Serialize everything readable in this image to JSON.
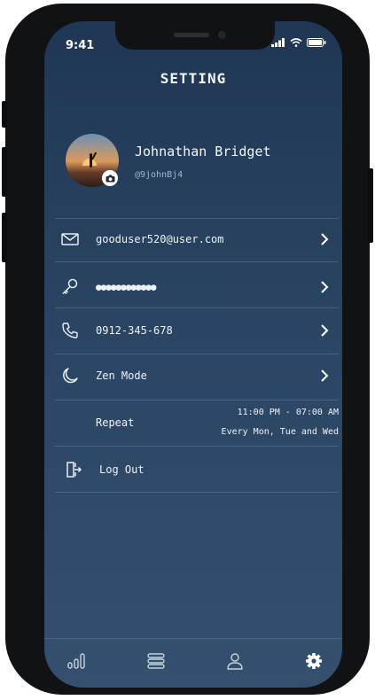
{
  "status_bar": {
    "time": "9:41"
  },
  "header": {
    "title": "SETTING"
  },
  "profile": {
    "name": "Johnathan Bridget",
    "handle": "@9johnBj4"
  },
  "settings": {
    "email": "gooduser520@user.com",
    "password": "●●●●●●●●●●●●",
    "phone": "0912-345-678",
    "zen_mode": "Zen Mode",
    "repeat_label": "Repeat",
    "repeat_time": "11:00 PM - 07:00 AM",
    "repeat_days": "Every Mon, Tue and Wed",
    "logout": "Log Out"
  },
  "tabs": [
    {
      "icon": "stats-icon"
    },
    {
      "icon": "list-icon"
    },
    {
      "icon": "user-icon"
    },
    {
      "icon": "gear-icon",
      "active": true
    }
  ],
  "colors": {
    "background_top": "#1f3754",
    "background_bottom": "#34506e",
    "text": "#eef2f7",
    "muted": "#a6b5c8"
  }
}
